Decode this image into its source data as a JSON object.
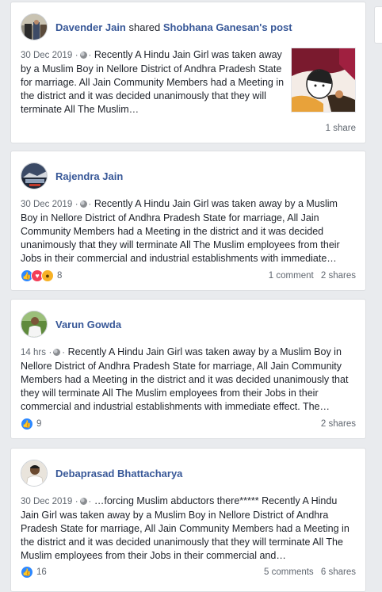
{
  "posts": [
    {
      "author": "Davender Jain",
      "shared_word": "shared",
      "shared_from": "Shobhana Ganesan's post",
      "date": "30 Dec 2019",
      "text": "Recently A Hindu Jain Girl was taken away by a Muslim Boy in Nellore District of Andhra Pradesh State for marriage. All Jain Community Members had a Meeting in the district and it was decided unanimously that they will terminate All The Muslim…",
      "reaction_count": "",
      "comments": "",
      "shares": "1 share"
    },
    {
      "author": "Rajendra Jain",
      "date": "30 Dec 2019",
      "text": "Recently A Hindu Jain Girl was taken away by a Muslim Boy in Nellore District of Andhra Pradesh State for marriage, All Jain Community Members had a Meeting in the district and it was decided unanimously that they will terminate All The Muslim employees from their Jobs in their commercial and industrial establishments with immediate…",
      "reaction_count": "8",
      "comments": "1 comment",
      "shares": "2 shares"
    },
    {
      "author": "Varun Gowda",
      "date": "14 hrs",
      "text": "Recently A Hindu Jain Girl was taken away by a Muslim Boy in Nellore District of Andhra Pradesh State for marriage, All Jain Community Members had a Meeting in the district and it was decided unanimously that they will terminate All The Muslim employees from their Jobs in their commercial and industrial establishments with immediate effect. The…",
      "reaction_count": "9",
      "comments": "",
      "shares": "2 shares"
    },
    {
      "author": "Debaprasad Bhattacharya",
      "date": "30 Dec 2019",
      "text": "…forcing Muslim abductors there***** Recently A Hindu Jain Girl was taken away by a Muslim Boy in Nellore District of Andhra Pradesh State for marriage, All Jain Community Members had a Meeting in the district and it was decided unanimously that they will terminate All The Muslim employees from their Jobs in their commercial and…",
      "reaction_count": "16",
      "comments": "5 comments",
      "shares": "6 shares"
    }
  ],
  "separator": "·",
  "colors": {
    "link": "#385898",
    "meta": "#606770",
    "like": "#2d88ff",
    "love": "#f33e58",
    "wow": "#f7b125"
  },
  "icons": [
    "globe-icon",
    "like-icon",
    "love-icon",
    "wow-icon"
  ]
}
